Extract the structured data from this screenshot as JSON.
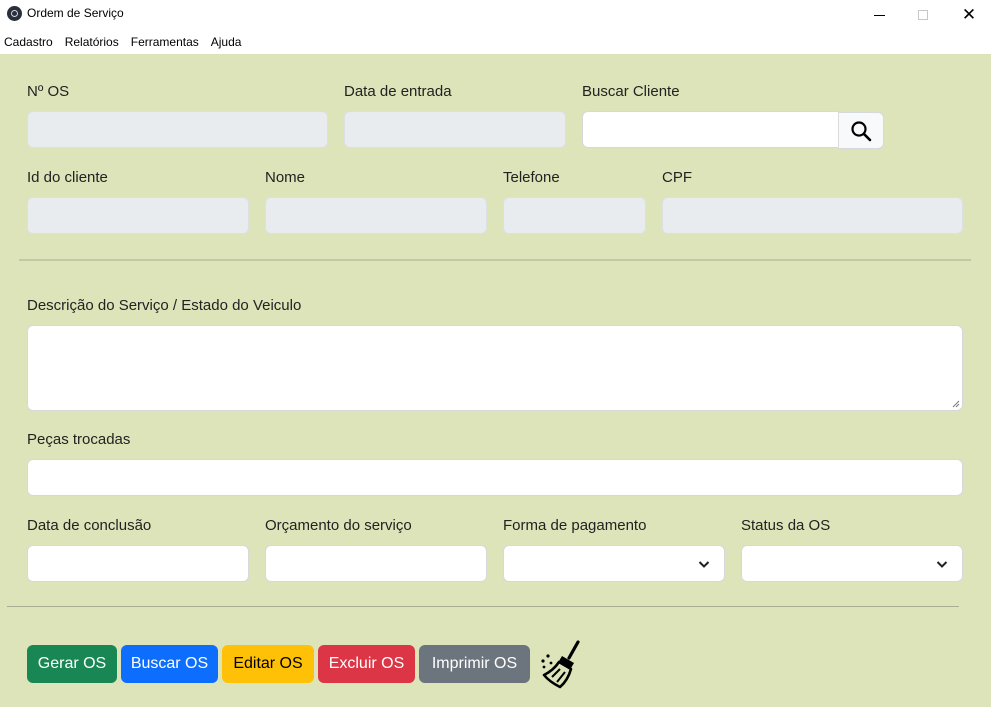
{
  "window": {
    "title": "Ordem de Serviço",
    "app_icon": "electron-atom-icon",
    "controls": {
      "minimize": "minimize-icon",
      "maximize": "maximize-icon",
      "close": "close-icon",
      "close_glyph": "✕"
    }
  },
  "menu": [
    "Cadastro",
    "Relatórios",
    "Ferramentas",
    "Ajuda"
  ],
  "form": {
    "numero_os": {
      "label": "Nº OS",
      "value": ""
    },
    "data_entrada": {
      "label": "Data de entrada",
      "value": ""
    },
    "buscar_cliente": {
      "label": "Buscar Cliente",
      "value": "",
      "button_icon": "search-icon"
    },
    "id_cliente": {
      "label": "Id do cliente",
      "value": ""
    },
    "nome": {
      "label": "Nome",
      "value": ""
    },
    "telefone": {
      "label": "Telefone",
      "value": ""
    },
    "cpf": {
      "label": "CPF",
      "value": ""
    },
    "descricao": {
      "label": "Descrição do Serviço / Estado do Veiculo",
      "value": ""
    },
    "pecas": {
      "label": "Peças trocadas",
      "value": ""
    },
    "data_conclusao": {
      "label": "Data de conclusão",
      "value": ""
    },
    "orcamento": {
      "label": "Orçamento do serviço",
      "value": ""
    },
    "forma_pagamento": {
      "label": "Forma de pagamento",
      "selected": ""
    },
    "status": {
      "label": "Status da OS",
      "selected": ""
    }
  },
  "buttons": {
    "gerar": "Gerar OS",
    "buscar": "Buscar OS",
    "editar": "Editar OS",
    "excluir": "Excluir OS",
    "imprimir": "Imprimir OS",
    "limpar_icon": "broom-icon"
  },
  "colors": {
    "background": "#dde4b9",
    "success": "#198754",
    "primary": "#0d6efd",
    "warning": "#ffc107",
    "danger": "#dc3545",
    "secondary": "#6c757d"
  }
}
